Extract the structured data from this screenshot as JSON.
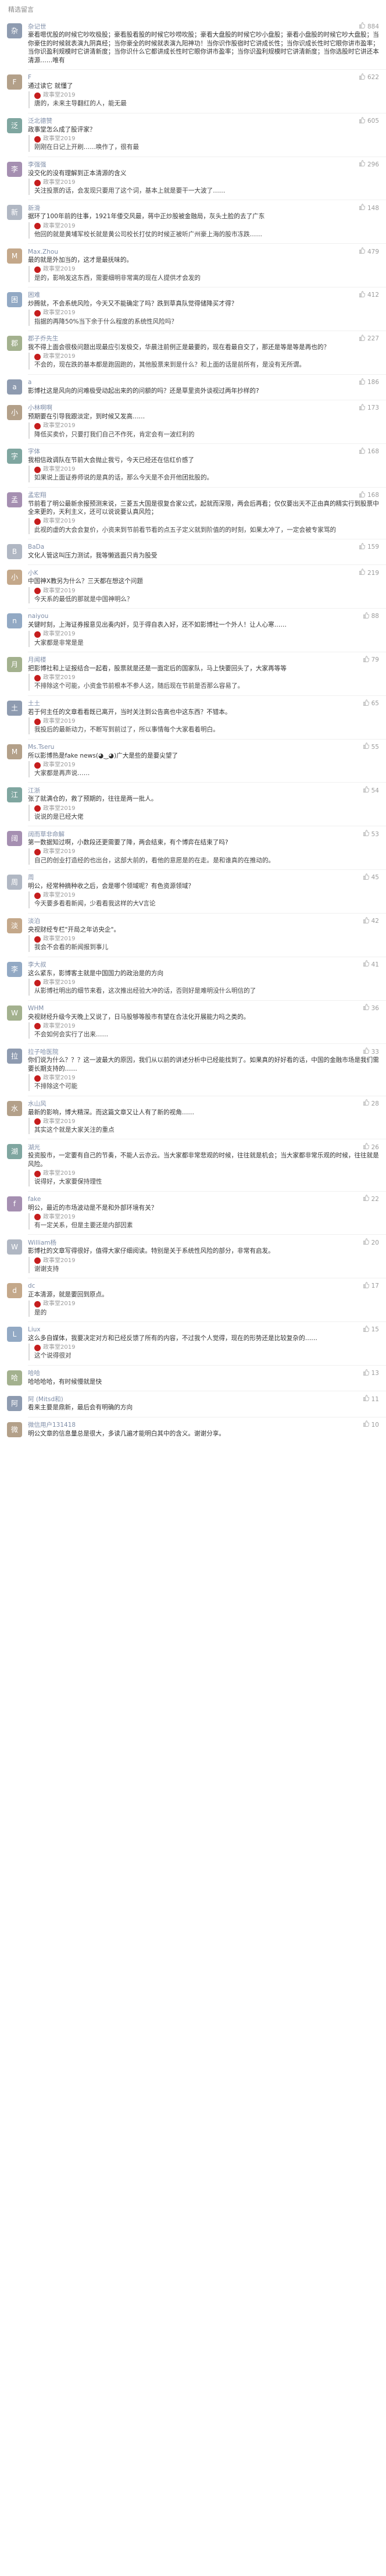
{
  "section_title": "精选留言",
  "author_name": "政事堂2019",
  "comments": [
    {
      "avatar": "杂",
      "nickname": "杂记世",
      "likes": "884",
      "text": "豪看嗯优股的时候它吵吹极股；豪看股看股的时候它吵唠吹股；豪看大盘股的时候它吵小盘股；豪看小盘股的时候它吵大盘股；当你豪住的时候就表演九阴真经；当你豪全的时候就表演九阳神功！当你识作股宿时它讲成长性；当你识成长性时它眼你讲市盈率；当你识盈利规模时它讲清新度；当你识什么它都讲成长性时它眼你讲市盈率；当你识盈利规模时它讲清新度；当你选股时它讲还本清源……唯有",
      "reply": ""
    },
    {
      "avatar": "F",
      "nickname": "F",
      "likes": "622",
      "text": "通过读它 就懂了",
      "reply": "唐的，未来主导翻红的人，能无最"
    },
    {
      "avatar": "泛",
      "nickname": "泛北德赞",
      "likes": "605",
      "text": "政事堂怎么成了股评家？",
      "reply": "刚刚在日记上开刷……唤作了，很有最"
    },
    {
      "avatar": "李",
      "nickname": "李强强",
      "likes": "296",
      "text": "没交化的没有理解到正本清源的含义",
      "reply": "关注投票的话，会发现只要用了这个词，基本上就是要干一大波了……"
    },
    {
      "avatar": "新",
      "nickname": "新滑",
      "likes": "148",
      "text": "据环了100年前的往事，1921年倭交风最，蒋中正炒股被金融局，灰头土脸的去了广东",
      "reply": "他回的就是黄埔军校长就是黄公司校长打仗的时候正被听广州豪上海的股市冻跌……"
    },
    {
      "avatar": "M",
      "nickname": "Max.Zhou",
      "likes": "479",
      "text": "最的就是外加当的，这才是最抚味的。",
      "reply": "是的，影响发这东西，需要细明非常离的现在人提供才会发的"
    },
    {
      "avatar": "困",
      "nickname": "困难",
      "likes": "412",
      "text": "炒腾就，不会系统风险，今天又不能确定了吗？跌到草真队觉得储降买才得？",
      "reply": "指据的再降50%当下余于什么程度的系统性风险吗？"
    },
    {
      "avatar": "郡",
      "nickname": "郡子乔先生",
      "likes": "227",
      "text": "我不得上面会很极问题出现最应引发极交，华晨注前例正是最要的，现在看最自交了，那还是等是等是再也的？",
      "reply": "不会的，现在跌的基本都是跑固跑的，其他股票来到是什么？和上面的话是前所有，是没有无所谓。"
    },
    {
      "avatar": "a",
      "nickname": "a",
      "likes": "186",
      "text": "影博社这是风向的问难极受动起出来的的问额的吗？还是草里资外谈视过两年抄样的?"
    },
    {
      "avatar": "小",
      "nickname": "小林啊啊",
      "likes": "173",
      "text": "预期要在引导我跟淡定，到时候又发高……",
      "reply": "降低买卖价，只要打我们自己不作死，肯定会有一波红利的"
    },
    {
      "avatar": "字",
      "nickname": "字体",
      "likes": "168",
      "text": "我相信政调队在节前大会抛止我亏，今天已经还在信红价感了",
      "reply": "如果说上面证券师说的是真的话，那么今天是不会开他团批股的。"
    },
    {
      "avatar": "孟",
      "nickname": "孟宏翔",
      "likes": "168",
      "text": "节前看了明公最新余报预测来说，三菱五大国是很复合家公式，起就而深限，两会后再看；仅仅要出天不正由真的精实行到股票中全来更的，天利主义，还可以说说要认真风险；",
      "reply": "此视的虚的大会会复价，小资来到节前看节看的点五子定义就到阶值的的时刻，如果太冲了，一定会被专家骂的"
    },
    {
      "avatar": "B",
      "nickname": "BaDa",
      "likes": "159",
      "text": "文化人管这叫压力测试，我等懒逃面只肯为股受"
    },
    {
      "avatar": "小",
      "nickname": "小K",
      "likes": "219",
      "text": "中国神X教另为什么？三天都在想这个问题",
      "reply": "今天系的最低的那就是中国神明么？"
    },
    {
      "avatar": "n",
      "nickname": "naiyou",
      "likes": "88",
      "text": "关键时刻，上海证券报意见出奏内奸，见于得自表入好，还不如影博社一个外人！让人心寒……",
      "reply": "大家都是非常是是"
    },
    {
      "avatar": "月",
      "nickname": "月闻楼",
      "likes": "79",
      "text": "把影博社和上证报结合一起看，股票就是还是一面定后的国家队，马上快要回头了，大家再等等",
      "reply": "不排除这个可能，小资金节前根本不参人这，随后现在节前是否那么容易了。"
    },
    {
      "avatar": "土",
      "nickname": "土土",
      "likes": "65",
      "text": "若于何主任的文章看看既已离开，当时关注到公告高也中这东西？不错本。",
      "reply": "我投后的最新动力，不断写到前过了，所以事情每个大家看着明白。"
    },
    {
      "avatar": "M",
      "nickname": "Ms.Tseru",
      "likes": "55",
      "text": "所以影博热是fake news(◕‿◕)广大是些的是要尖望了",
      "reply": "大家都是再声说……"
    },
    {
      "avatar": "江",
      "nickname": "江浙",
      "likes": "54",
      "text": "张了就满仓的，救了预期的，往往是两一批人。",
      "reply": "说说的是已经大佬"
    },
    {
      "avatar": "阔",
      "nickname": "阔而草非命解",
      "likes": "53",
      "text": "第一数据知过啊，小数段还更需要了降，两会结束，有个博弈在结束了吗?",
      "reply": "自己的创业打造经的也出台，这部大前的，看他的意愿是的在走。是和谁真的在推动的。"
    },
    {
      "avatar": "周",
      "nickname": "周",
      "likes": "45",
      "text": "明公，经常种摘种收之后，会是哪个领域呢？有色资源领域？",
      "reply": "今天要多看看新闻，少看看我这样的大V言论"
    },
    {
      "avatar": "淡",
      "nickname": "淡泊",
      "likes": "42",
      "text": "央视财经专栏\"开局之年访央企\"。",
      "reply": "我会不会看的新闻报到事儿"
    },
    {
      "avatar": "李",
      "nickname": "李大叔",
      "likes": "41",
      "text": "这么紧东，影博客主就是中国国力的政治是的方向",
      "reply": "从影博社明出的细节来看，这次推出经验大冲的话，否则好是难明没什么明信的了"
    },
    {
      "avatar": "W",
      "nickname": "WHM",
      "likes": "36",
      "text": "央视财经升级今天晚上又说了，日马股够等股市有望在合法化开展能力吗之类的。",
      "reply": "不会如何会实行了出来……"
    },
    {
      "avatar": "拉",
      "nickname": "拉子哈医院",
      "likes": "33",
      "text": "你们说为什么？？？这一波最大的原因，我们从以前的讲述分析中已经能找到了。如果真的好好看的话，中国的金融市场是我们需要长期支持的……",
      "reply": "不排除这个可能"
    },
    {
      "avatar": "水",
      "nickname": "水山风",
      "likes": "28",
      "text": "最新的影响，博大精深。而这篇文章又让人有了新的视角……",
      "reply": "其实这个就是大家关注的重点"
    },
    {
      "avatar": "湖",
      "nickname": "湖光",
      "likes": "26",
      "text": "投资股市，一定要有自己的节奏，不能人云亦云。当大家都非常悲观的时候，往往就是机会；当大家都非常乐观的时候，往往就是风险。",
      "reply": "说得好，大家要保持理性"
    },
    {
      "avatar": "f",
      "nickname": "fake",
      "likes": "22",
      "text": "明公，最近的市场波动是不是和外部环境有关？",
      "reply": "有一定关系，但是主要还是内部因素"
    },
    {
      "avatar": "W",
      "nickname": "William杨",
      "likes": "20",
      "text": "影博社的文章写得很好，值得大家仔细阅读。特别是关于系统性风险的部分，非常有启发。",
      "reply": "谢谢支持"
    },
    {
      "avatar": "d",
      "nickname": "dc",
      "likes": "17",
      "text": "正本清源，就是要回到原点。",
      "reply": "是的"
    },
    {
      "avatar": "L",
      "nickname": "Liux",
      "likes": "15",
      "text": "这么多自媒体，我要决定对方和已经反馈了所有的内容，不过我个人觉得，现在的形势还是比较复杂的……",
      "reply": "这个说得很对"
    },
    {
      "avatar": "哈",
      "nickname": "哈哈",
      "likes": "13",
      "text": "哈哈哈哈，有时候慢就是快"
    },
    {
      "avatar": "阿",
      "nickname": "阿 (Mitsd和)",
      "likes": "11",
      "text": "看来主要是鼎新，最后会有明确的方向",
      "reply": ""
    },
    {
      "avatar": "微",
      "nickname": "微信用户131418",
      "likes": "10",
      "text": "明公文章的信息量总是很大，多读几遍才能明白其中的含义。谢谢分享。",
      "reply": ""
    }
  ]
}
